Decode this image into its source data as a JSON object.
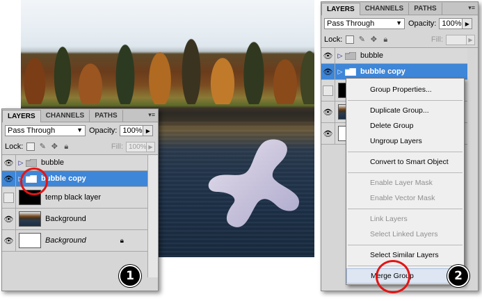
{
  "left_panel": {
    "tabs": [
      "LAYERS",
      "CHANNELS",
      "PATHS"
    ],
    "blend_mode": "Pass Through",
    "opacity_label": "Opacity:",
    "opacity_value": "100%",
    "lock_label": "Lock:",
    "fill_label": "Fill:",
    "fill_value": "100%",
    "layers": [
      {
        "name": "bubble",
        "type": "group",
        "visible": true
      },
      {
        "name": "bubble copy",
        "type": "group",
        "visible": true,
        "selected": true
      },
      {
        "name": "temp black layer",
        "type": "layer",
        "visible": false
      },
      {
        "name": "Background",
        "type": "layer",
        "visible": true
      },
      {
        "name": "Background",
        "type": "layer",
        "visible": true,
        "locked": true
      }
    ],
    "step_number": "1"
  },
  "right_panel": {
    "tabs": [
      "LAYERS",
      "CHANNELS",
      "PATHS"
    ],
    "blend_mode": "Pass Through",
    "opacity_label": "Opacity:",
    "opacity_value": "100%",
    "lock_label": "Lock:",
    "fill_label": "Fill:",
    "layers": [
      {
        "name": "bubble"
      },
      {
        "name": "bubble copy",
        "selected": true
      }
    ],
    "step_number": "2"
  },
  "context_menu": {
    "items": [
      {
        "label": "Group Properties...",
        "enabled": true
      },
      {
        "label": "Duplicate Group...",
        "enabled": true
      },
      {
        "label": "Delete Group",
        "enabled": true
      },
      {
        "label": "Ungroup Layers",
        "enabled": true
      },
      {
        "label": "Convert to Smart Object",
        "enabled": true
      },
      {
        "label": "Enable Layer Mask",
        "enabled": false
      },
      {
        "label": "Enable Vector Mask",
        "enabled": false
      },
      {
        "label": "Link Layers",
        "enabled": false
      },
      {
        "label": "Select Linked Layers",
        "enabled": false
      },
      {
        "label": "Select Similar Layers",
        "enabled": true
      },
      {
        "label": "Merge Group",
        "enabled": true,
        "highlighted": true
      }
    ]
  },
  "colors": {
    "selection": "#3e86d8",
    "annotation_circle": "#e21515",
    "panel_bg": "#d6d6d6"
  }
}
